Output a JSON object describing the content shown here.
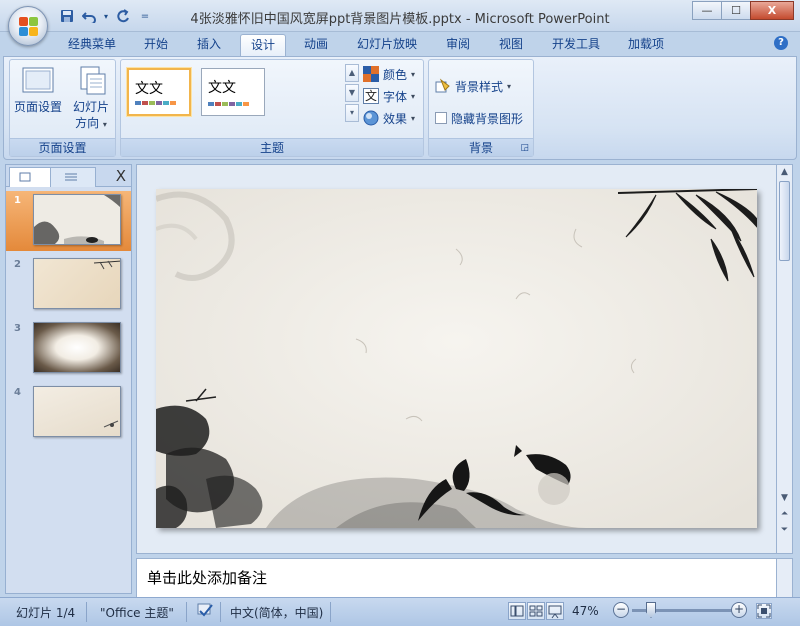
{
  "window": {
    "title": "4张淡雅怀旧中国风宽屏ppt背景图片模板.pptx - Microsoft PowerPoint",
    "minimize": "—",
    "maximize": "☐",
    "close": "X"
  },
  "quick_access": {
    "save_icon": "save-icon",
    "undo_icon": "undo-icon",
    "redo_icon": "redo-icon",
    "customize": "="
  },
  "ribbon_tabs": [
    {
      "label": "经典菜单"
    },
    {
      "label": "开始"
    },
    {
      "label": "插入"
    },
    {
      "label": "设计",
      "active": true
    },
    {
      "label": "动画"
    },
    {
      "label": "幻灯片放映"
    },
    {
      "label": "审阅"
    },
    {
      "label": "视图"
    },
    {
      "label": "开发工具"
    },
    {
      "label": "加载项"
    }
  ],
  "page_setup_group": {
    "label": "页面设置",
    "page_setup_btn": "页面设置",
    "orientation_line1": "幻灯片",
    "orientation_line2": "方向"
  },
  "theme_group": {
    "label": "主题",
    "theme1_text": "文文",
    "theme2_text": "文文",
    "colors": "颜色",
    "fonts": "字体",
    "effects": "效果",
    "font_icon_char": "文"
  },
  "background_group": {
    "label": "背景",
    "bg_styles": "背景样式",
    "hide_bg": "隐藏背景图形"
  },
  "slides_pane": {
    "slides": [
      {
        "num": "1"
      },
      {
        "num": "2"
      },
      {
        "num": "3"
      },
      {
        "num": "4"
      }
    ],
    "close": "X"
  },
  "notes": {
    "placeholder": "单击此处添加备注"
  },
  "status": {
    "slide": "幻灯片 1/4",
    "theme": "\"Office 主题\"",
    "language": "中文(简体，中国)",
    "zoom": "47%",
    "zoom_value": 47
  },
  "colors": {
    "accent": "#15428b",
    "selected_slide": "#e4893a",
    "ribbon_bg": "#d6e3f3"
  }
}
